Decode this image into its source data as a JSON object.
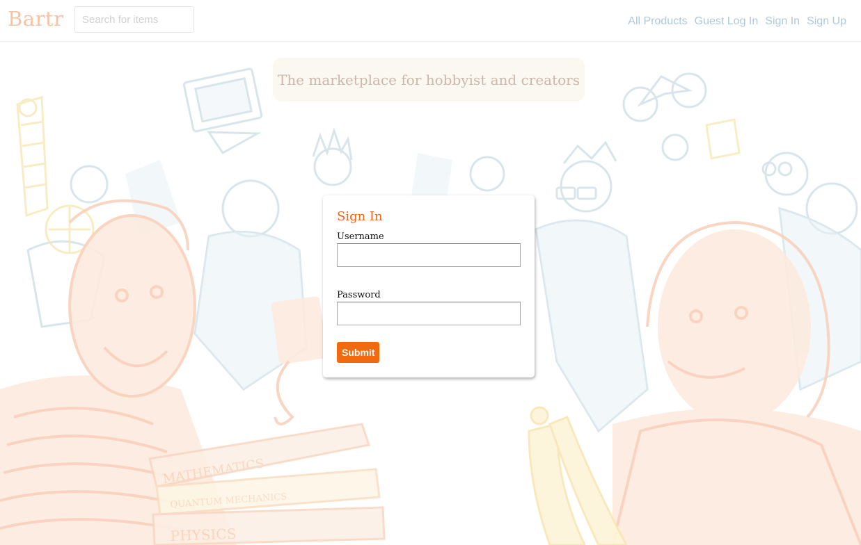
{
  "navbar": {
    "brand": "Bartr",
    "search_placeholder": "Search for items",
    "links": [
      "All Products",
      "Guest Log In",
      "Sign In",
      "Sign Up"
    ]
  },
  "tagline": "The marketplace for hobbyist and creators",
  "sign_in": {
    "title": "Sign In",
    "username_label": "Username",
    "username_value": "",
    "password_label": "Password",
    "password_value": "",
    "submit_label": "Submit"
  },
  "illustration": {
    "book_labels": [
      "MATHEMATICS",
      "QUANTUM MECHANICS",
      "PHYSICS"
    ]
  },
  "colors": {
    "brand": "#f7c3a4",
    "accent": "#f26a10",
    "nav_link": "#aec9d8",
    "title": "#f2651e"
  }
}
